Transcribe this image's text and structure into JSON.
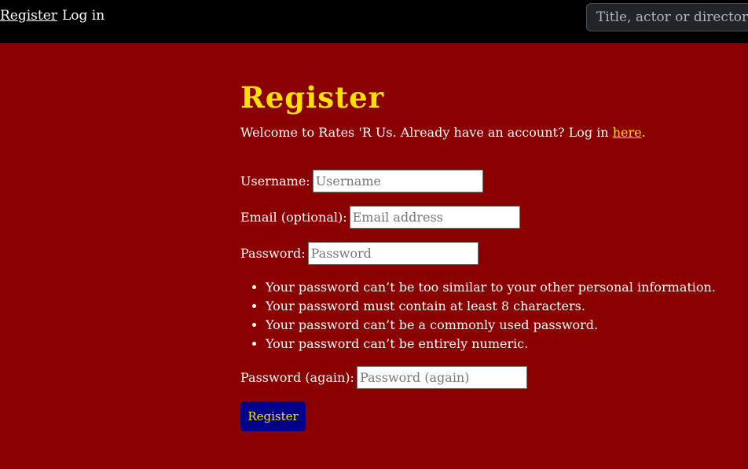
{
  "nav": {
    "register_label": "Register",
    "login_label": "Log in",
    "search_placeholder": "Title, actor or director"
  },
  "page": {
    "title": "Register",
    "welcome_text": "Welcome to Rates 'R Us. Already have an account? Log in ",
    "welcome_link": "here",
    "welcome_end": "."
  },
  "form": {
    "username": {
      "label": "Username:",
      "placeholder": "Username",
      "value": ""
    },
    "email": {
      "label": "Email (optional):",
      "placeholder": "Email address",
      "value": ""
    },
    "password": {
      "label": "Password:",
      "placeholder": "Password",
      "value": ""
    },
    "password_help": [
      "Your password can’t be too similar to your other personal information.",
      "Your password must contain at least 8 characters.",
      "Your password can’t be a commonly used password.",
      "Your password can’t be entirely numeric."
    ],
    "password2": {
      "label": "Password (again):",
      "placeholder": "Password (again)",
      "value": ""
    },
    "submit_label": "Register"
  },
  "colors": {
    "background": "#8b0000",
    "navbar": "#000000",
    "accent": "#ffe000",
    "button": "#00008b"
  }
}
